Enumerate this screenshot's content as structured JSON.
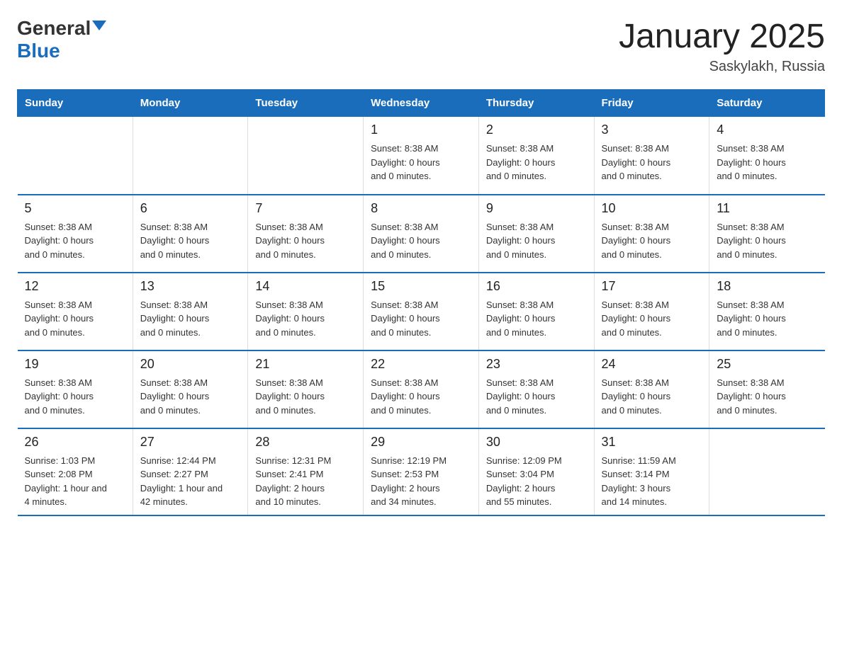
{
  "header": {
    "logo_general": "General",
    "logo_blue": "Blue",
    "title": "January 2025",
    "subtitle": "Saskylakh, Russia"
  },
  "days_of_week": [
    "Sunday",
    "Monday",
    "Tuesday",
    "Wednesday",
    "Thursday",
    "Friday",
    "Saturday"
  ],
  "weeks": [
    [
      {
        "day": "",
        "info": ""
      },
      {
        "day": "",
        "info": ""
      },
      {
        "day": "",
        "info": ""
      },
      {
        "day": "1",
        "info": "Sunset: 8:38 AM\nDaylight: 0 hours\nand 0 minutes."
      },
      {
        "day": "2",
        "info": "Sunset: 8:38 AM\nDaylight: 0 hours\nand 0 minutes."
      },
      {
        "day": "3",
        "info": "Sunset: 8:38 AM\nDaylight: 0 hours\nand 0 minutes."
      },
      {
        "day": "4",
        "info": "Sunset: 8:38 AM\nDaylight: 0 hours\nand 0 minutes."
      }
    ],
    [
      {
        "day": "5",
        "info": "Sunset: 8:38 AM\nDaylight: 0 hours\nand 0 minutes."
      },
      {
        "day": "6",
        "info": "Sunset: 8:38 AM\nDaylight: 0 hours\nand 0 minutes."
      },
      {
        "day": "7",
        "info": "Sunset: 8:38 AM\nDaylight: 0 hours\nand 0 minutes."
      },
      {
        "day": "8",
        "info": "Sunset: 8:38 AM\nDaylight: 0 hours\nand 0 minutes."
      },
      {
        "day": "9",
        "info": "Sunset: 8:38 AM\nDaylight: 0 hours\nand 0 minutes."
      },
      {
        "day": "10",
        "info": "Sunset: 8:38 AM\nDaylight: 0 hours\nand 0 minutes."
      },
      {
        "day": "11",
        "info": "Sunset: 8:38 AM\nDaylight: 0 hours\nand 0 minutes."
      }
    ],
    [
      {
        "day": "12",
        "info": "Sunset: 8:38 AM\nDaylight: 0 hours\nand 0 minutes."
      },
      {
        "day": "13",
        "info": "Sunset: 8:38 AM\nDaylight: 0 hours\nand 0 minutes."
      },
      {
        "day": "14",
        "info": "Sunset: 8:38 AM\nDaylight: 0 hours\nand 0 minutes."
      },
      {
        "day": "15",
        "info": "Sunset: 8:38 AM\nDaylight: 0 hours\nand 0 minutes."
      },
      {
        "day": "16",
        "info": "Sunset: 8:38 AM\nDaylight: 0 hours\nand 0 minutes."
      },
      {
        "day": "17",
        "info": "Sunset: 8:38 AM\nDaylight: 0 hours\nand 0 minutes."
      },
      {
        "day": "18",
        "info": "Sunset: 8:38 AM\nDaylight: 0 hours\nand 0 minutes."
      }
    ],
    [
      {
        "day": "19",
        "info": "Sunset: 8:38 AM\nDaylight: 0 hours\nand 0 minutes."
      },
      {
        "day": "20",
        "info": "Sunset: 8:38 AM\nDaylight: 0 hours\nand 0 minutes."
      },
      {
        "day": "21",
        "info": "Sunset: 8:38 AM\nDaylight: 0 hours\nand 0 minutes."
      },
      {
        "day": "22",
        "info": "Sunset: 8:38 AM\nDaylight: 0 hours\nand 0 minutes."
      },
      {
        "day": "23",
        "info": "Sunset: 8:38 AM\nDaylight: 0 hours\nand 0 minutes."
      },
      {
        "day": "24",
        "info": "Sunset: 8:38 AM\nDaylight: 0 hours\nand 0 minutes."
      },
      {
        "day": "25",
        "info": "Sunset: 8:38 AM\nDaylight: 0 hours\nand 0 minutes."
      }
    ],
    [
      {
        "day": "26",
        "info": "Sunrise: 1:03 PM\nSunset: 2:08 PM\nDaylight: 1 hour and\n4 minutes."
      },
      {
        "day": "27",
        "info": "Sunrise: 12:44 PM\nSunset: 2:27 PM\nDaylight: 1 hour and\n42 minutes."
      },
      {
        "day": "28",
        "info": "Sunrise: 12:31 PM\nSunset: 2:41 PM\nDaylight: 2 hours\nand 10 minutes."
      },
      {
        "day": "29",
        "info": "Sunrise: 12:19 PM\nSunset: 2:53 PM\nDaylight: 2 hours\nand 34 minutes."
      },
      {
        "day": "30",
        "info": "Sunrise: 12:09 PM\nSunset: 3:04 PM\nDaylight: 2 hours\nand 55 minutes."
      },
      {
        "day": "31",
        "info": "Sunrise: 11:59 AM\nSunset: 3:14 PM\nDaylight: 3 hours\nand 14 minutes."
      },
      {
        "day": "",
        "info": ""
      }
    ]
  ]
}
